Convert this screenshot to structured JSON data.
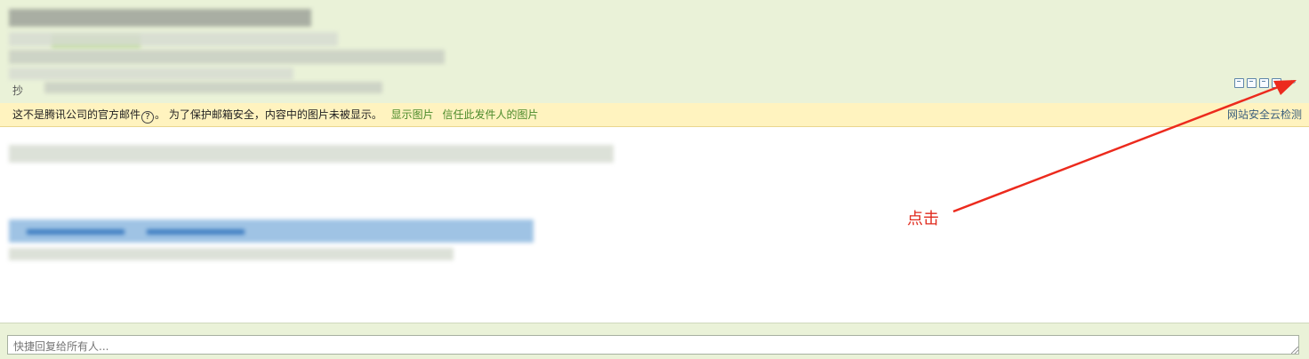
{
  "header": {
    "cc_label": "抄",
    "toolbar_icons": [
      "window-icon",
      "print-preview-icon",
      "download-icon",
      "print-icon",
      "expand-icon"
    ]
  },
  "warning_bar": {
    "message_prefix": "这不是腾讯公司的官方邮件",
    "help_glyph": "?",
    "message_suffix": "。 为了保护邮箱安全，内容中的图片未被显示。",
    "show_images_link": "显示图片",
    "trust_sender_link": "信任此发件人的图片",
    "cloud_check_link": "网站安全云检测"
  },
  "annotation": {
    "text": "点击",
    "color": "#e02a1d"
  },
  "reply": {
    "placeholder": "快捷回复给所有人..."
  },
  "colors": {
    "header_bg": "#eaf2d8",
    "warning_bg": "#fff3bf",
    "link_green": "#4a8a2a"
  }
}
